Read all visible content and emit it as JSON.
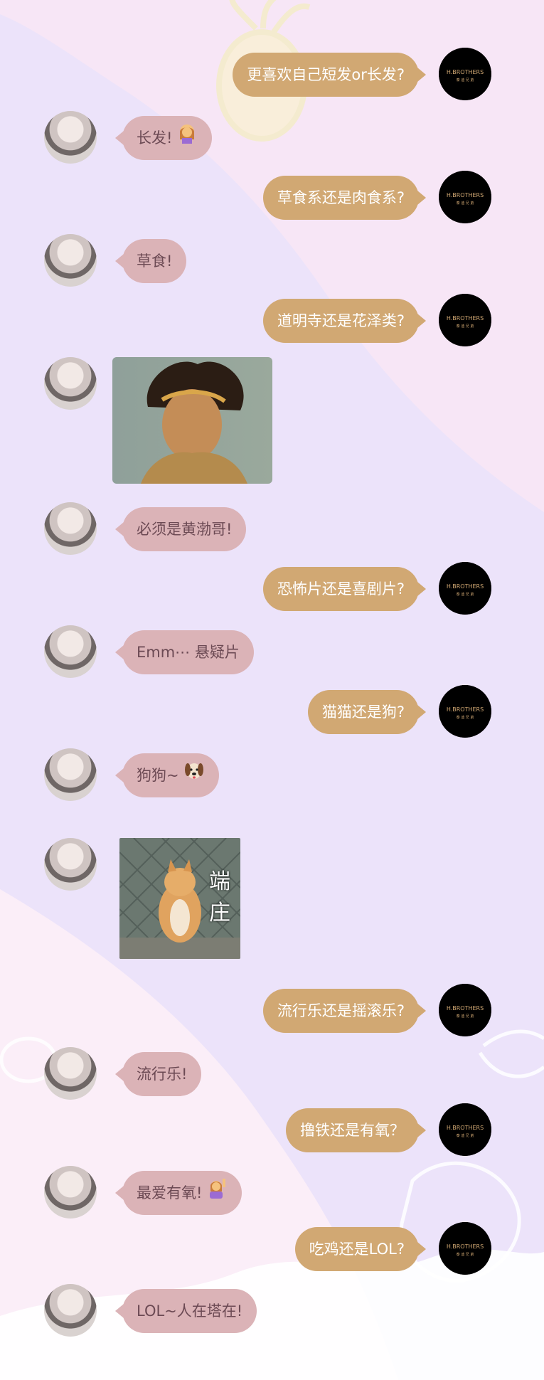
{
  "brand": {
    "logo_text": "H.BROTHERS",
    "logo_subtext": "泰 迪 兄 弟"
  },
  "messages": [
    {
      "side": "right",
      "text": "更喜欢自己短发or长发?"
    },
    {
      "side": "left",
      "text": "长发!"
    },
    {
      "side": "right",
      "text": "草食系还是肉食系?"
    },
    {
      "side": "left",
      "text": "草食!"
    },
    {
      "side": "right",
      "text": "道明寺还是花泽类?"
    },
    {
      "side": "left",
      "type": "image",
      "alt": "monkey king meme photo"
    },
    {
      "side": "left",
      "text": "必须是黄渤哥!"
    },
    {
      "side": "right",
      "text": "恐怖片还是喜剧片?"
    },
    {
      "side": "left",
      "text": "Emm⋯ 悬疑片"
    },
    {
      "side": "right",
      "text": "猫猫还是狗?"
    },
    {
      "side": "left",
      "text": "狗狗~"
    },
    {
      "side": "left",
      "type": "image",
      "alt": "shiba dog photo",
      "caption": [
        "端",
        "庄"
      ]
    },
    {
      "side": "right",
      "text": "流行乐还是摇滚乐?"
    },
    {
      "side": "left",
      "text": "流行乐!"
    },
    {
      "side": "right",
      "text": "撸铁还是有氧？"
    },
    {
      "side": "left",
      "text": "最爱有氧!"
    },
    {
      "side": "right",
      "text": "吃鸡还是LOL?"
    },
    {
      "side": "left",
      "text": "LOL~人在塔在!"
    }
  ],
  "colors": {
    "left_bubble": "#dbb3b7",
    "right_bubble": "#d1a873",
    "left_text": "#6c4a54",
    "right_text": "#ffffff"
  }
}
